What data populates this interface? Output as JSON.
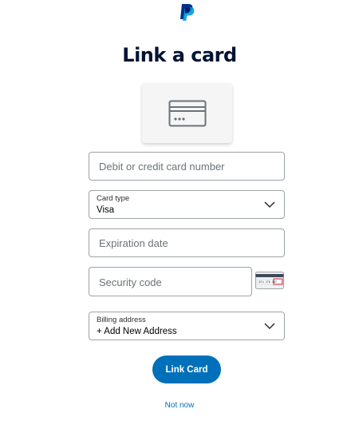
{
  "header": {
    "logo_icon": "paypal-logo-icon",
    "title": "Link a card"
  },
  "illustration": {
    "icon": "credit-card-icon"
  },
  "form": {
    "card_number": {
      "placeholder": "Debit or credit card number"
    },
    "card_type": {
      "label": "Card type",
      "value": "Visa"
    },
    "expiration": {
      "placeholder": "Expiration date"
    },
    "security": {
      "placeholder": "Security code",
      "help_icon": "card-back-cvv-icon",
      "card_text": "874 376 587"
    },
    "billing": {
      "label": "Billing address",
      "value": "+ Add New Address"
    }
  },
  "actions": {
    "link_label": "Link Card",
    "not_now_label": "Not now"
  },
  "colors": {
    "primary": "#0070ba",
    "title": "#001435",
    "border": "#9da3a6"
  }
}
